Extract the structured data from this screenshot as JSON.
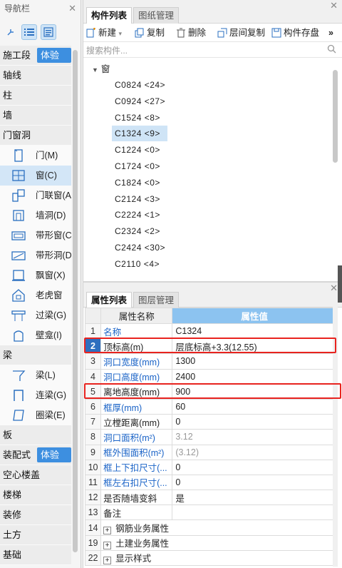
{
  "nav": {
    "title": "导航栏",
    "categories": [
      {
        "label": "施工段",
        "tag": "体验版"
      },
      {
        "label": "轴线"
      },
      {
        "label": "柱"
      },
      {
        "label": "墙"
      },
      {
        "label": "门窗洞"
      },
      {
        "label": "梁"
      },
      {
        "label": "板"
      },
      {
        "label": "装配式",
        "tag": "体验版"
      },
      {
        "label": "空心楼盖"
      },
      {
        "label": "楼梯"
      },
      {
        "label": "装修"
      },
      {
        "label": "土方"
      },
      {
        "label": "基础"
      }
    ],
    "door_items": [
      "门(M)",
      "窗(C)",
      "门联窗(A",
      "墙洞(D)",
      "带形窗(C",
      "带形洞(D",
      "飘窗(X)",
      "老虎窗",
      "过梁(G)",
      "壁龛(I)"
    ],
    "beam_items": [
      "梁(L)",
      "连梁(G)",
      "圈梁(E)"
    ]
  },
  "component": {
    "tabs": [
      "构件列表",
      "图纸管理"
    ],
    "toolbar": {
      "new": "新建",
      "copy": "复制",
      "delete": "删除",
      "floor_copy": "层间复制",
      "store": "构件存盘",
      "more": "»"
    },
    "search_placeholder": "搜索构件...",
    "tree_root": "窗",
    "items": [
      "C0824 <24>",
      "C0924 <27>",
      "C1524 <8>",
      "C1324 <9>",
      "C1224 <0>",
      "C1724 <0>",
      "C1824 <0>",
      "C2124 <3>",
      "C2224 <1>",
      "C2324 <2>",
      "C2424 <30>",
      "C2110 <4>"
    ],
    "selected_index": 3
  },
  "properties": {
    "tabs": [
      "属性列表",
      "图层管理"
    ],
    "col_name": "属性名称",
    "col_value": "属性值",
    "rows": [
      {
        "num": "1",
        "name": "名称",
        "value": "C1324"
      },
      {
        "num": "2",
        "name": "顶标高(m)",
        "value": "层底标高+3.3(12.55)"
      },
      {
        "num": "3",
        "name": "洞口宽度(mm)",
        "value": "1300"
      },
      {
        "num": "4",
        "name": "洞口高度(mm)",
        "value": "2400"
      },
      {
        "num": "5",
        "name": "离地高度(mm)",
        "value": "900"
      },
      {
        "num": "6",
        "name": "框厚(mm)",
        "value": "60"
      },
      {
        "num": "7",
        "name": "立樘距离(mm)",
        "value": "0"
      },
      {
        "num": "8",
        "name": "洞口面积(m²)",
        "value": "3.12"
      },
      {
        "num": "9",
        "name": "框外围面积(m²)",
        "value": "(3.12)"
      },
      {
        "num": "10",
        "name": "框上下扣尺寸(...",
        "value": "0"
      },
      {
        "num": "11",
        "name": "框左右扣尺寸(...",
        "value": "0"
      },
      {
        "num": "12",
        "name": "是否随墙变斜",
        "value": "是"
      },
      {
        "num": "13",
        "name": "备注",
        "value": ""
      },
      {
        "num": "14",
        "name": "钢筋业务属性",
        "value": ""
      },
      {
        "num": "19",
        "name": "土建业务属性",
        "value": ""
      },
      {
        "num": "22",
        "name": "显示样式",
        "value": ""
      }
    ]
  },
  "colors": {
    "accent": "#3d8fe0",
    "highlight": "#e8231f",
    "header_value": "#8cc3f0",
    "link_blue": "#1a63c7"
  }
}
